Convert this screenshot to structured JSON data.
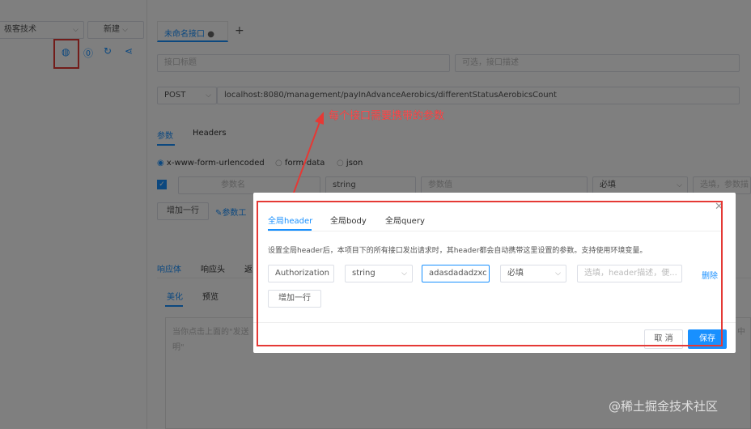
{
  "sidebar": {
    "project_select": "极客技术",
    "new_button": "新建"
  },
  "main": {
    "tab_title": "未命名接口",
    "name_placeholder": "接口标题",
    "desc_placeholder": "可选，接口描述",
    "method": "POST",
    "url": "localhost:8080/management/payInAdvanceAerobics/differentStatusAerobicsCount",
    "annotation": "每个接口需要携带的参数",
    "param_tabs": [
      "参数",
      "Headers"
    ],
    "body_types": [
      "x-www-form-urlencoded",
      "form-data",
      "json"
    ],
    "param_row": {
      "name_placeholder": "参数名",
      "type": "string",
      "value_placeholder": "参数值",
      "required": "必填",
      "desc_placeholder": "选填，参数描"
    },
    "add_row": "增加一行",
    "param_tool": "参数工",
    "response_tabs": [
      "响应体",
      "响应头",
      "返"
    ],
    "response_subtabs": [
      "美化",
      "预览"
    ],
    "response_placeholder_line1": "当你点击上面的\"发送",
    "response_placeholder_line2": "明\"",
    "response_placeholder_right": "中"
  },
  "modal": {
    "tabs": [
      "全局header",
      "全局body",
      "全局query"
    ],
    "description": "设置全局header后，本项目下的所有接口发出请求时，其header都会自动携带这里设置的参数。支持使用环境变量。",
    "row": {
      "name": "Authorization",
      "type": "string",
      "value": "adasdadadzxc",
      "required": "必填",
      "desc_placeholder": "选填，header描述，便..."
    },
    "delete": "删除",
    "add_row": "增加一行",
    "cancel": "取 消",
    "save": "保存"
  },
  "watermark": "@稀土掘金技术社区",
  "colors": {
    "accent": "#1890ff",
    "annotation_red": "#e53935"
  }
}
